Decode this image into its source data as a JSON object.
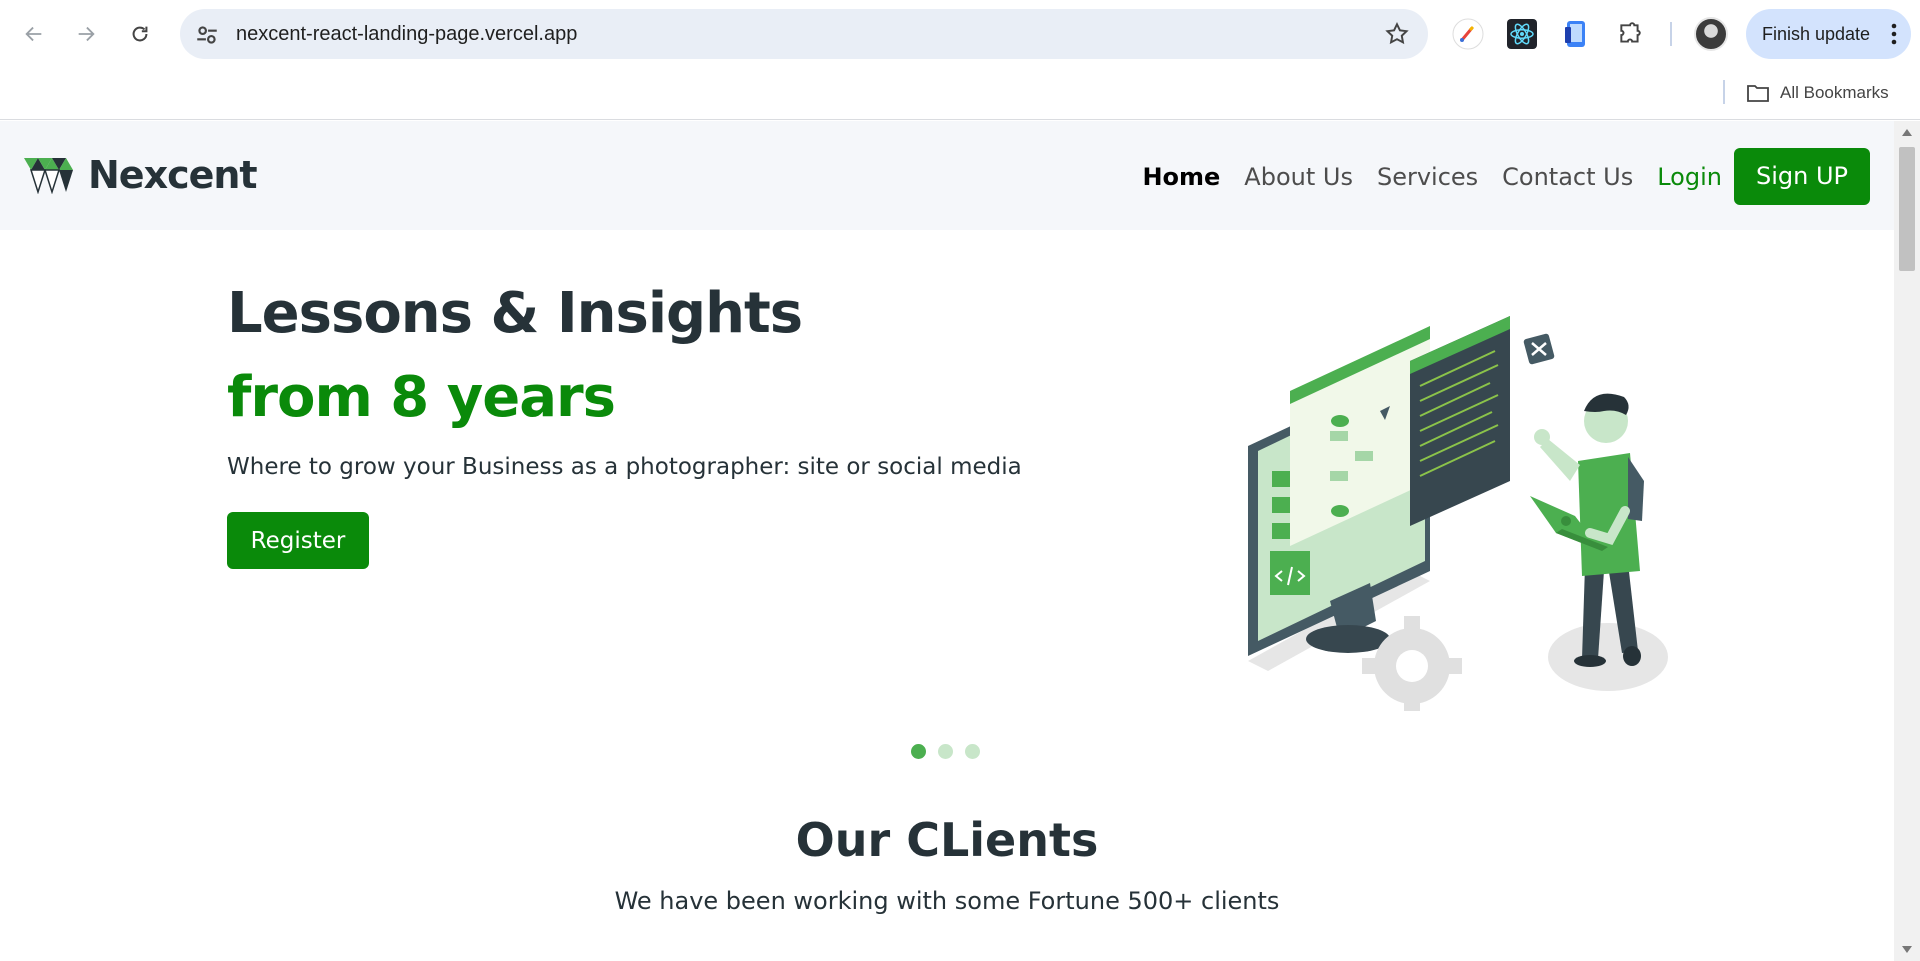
{
  "browser": {
    "url": "nexcent-react-landing-page.vercel.app",
    "finish_update_label": "Finish update",
    "all_bookmarks_label": "All Bookmarks"
  },
  "site": {
    "logo_text": "Nexcent",
    "nav": {
      "home": "Home",
      "about": "About Us",
      "services": "Services",
      "contact": "Contact Us",
      "login": "Login",
      "signup": "Sign UP"
    }
  },
  "hero": {
    "title": "Lessons & Insights",
    "accent": "from 8 years",
    "subtitle": "Where to grow your Business as a photographer: site or social media",
    "register_label": "Register",
    "slides_count": 3,
    "active_slide": 1
  },
  "clients": {
    "title": "Our CLients",
    "subtitle": "We have been working with some Fortune 500+ clients"
  },
  "colors": {
    "brand_green": "#0a8a0a",
    "dark_text": "#263238",
    "header_bg": "#f5f7fa",
    "omnibox_bg": "#e9eef6",
    "update_bg": "#d3e3fd"
  },
  "icons": [
    "back-arrow-icon",
    "forward-arrow-icon",
    "reload-icon",
    "site-settings-icon",
    "bookmark-star-icon",
    "color-picker-extension-icon",
    "react-devtools-icon",
    "device-extension-icon",
    "extensions-puzzle-icon",
    "profile-avatar",
    "more-vert-icon",
    "folder-icon"
  ]
}
